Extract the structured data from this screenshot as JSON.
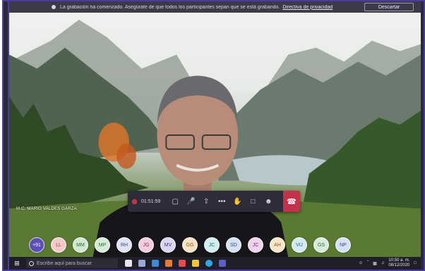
{
  "banner": {
    "text": "La grabación ha comenzado. Asegúrate de que todos los participantes sepan que se está grabando.",
    "link": "Directiva de privacidad",
    "dismiss_label": "Descartar"
  },
  "speaker": {
    "name": "M.C. MARIO VALDES GARZA"
  },
  "controls": {
    "timer": "01:51:59",
    "icons": [
      "camera-off-icon",
      "mic-icon",
      "share-icon",
      "more-icon",
      "raise-hand-icon",
      "chat-icon",
      "participants-icon",
      "hangup-icon"
    ]
  },
  "participants": [
    {
      "initials": "+91",
      "bg": "#5b50b8",
      "fg": "#ffffff"
    },
    {
      "initials": "LL",
      "bg": "#f5c9c9",
      "fg": "#9b3b3b"
    },
    {
      "initials": "MM",
      "bg": "#cfe8d2",
      "fg": "#2e6b3a"
    },
    {
      "initials": "MP",
      "bg": "#d6ecd8",
      "fg": "#2e6b3a"
    },
    {
      "initials": "RH",
      "bg": "#dfe3f2",
      "fg": "#3a447a"
    },
    {
      "initials": "JG",
      "bg": "#f3cce0",
      "fg": "#8a2d5c"
    },
    {
      "initials": "MV",
      "bg": "#d9d6f3",
      "fg": "#43399a"
    },
    {
      "initials": "GG",
      "bg": "#f7e2c4",
      "fg": "#8a5a1a"
    },
    {
      "initials": "JC",
      "bg": "#d3eef0",
      "fg": "#24666d"
    },
    {
      "initials": "SD",
      "bg": "#d5e1f5",
      "fg": "#2c4d8a"
    },
    {
      "initials": "JC",
      "bg": "#eed3ee",
      "fg": "#7a2b7a"
    },
    {
      "initials": "AH",
      "bg": "#f9e6c9",
      "fg": "#8a5a1a"
    },
    {
      "initials": "VU",
      "bg": "#d3eaf5",
      "fg": "#24607d"
    },
    {
      "initials": "GS",
      "bg": "#d6ecd8",
      "fg": "#2e6b3a"
    },
    {
      "initials": "NP",
      "bg": "#d5e1f5",
      "fg": "#2c4d8a"
    }
  ],
  "taskbar": {
    "search_placeholder": "Escribe aquí para buscar",
    "time": "10:50 a. m.",
    "date": "08/12/2020"
  }
}
